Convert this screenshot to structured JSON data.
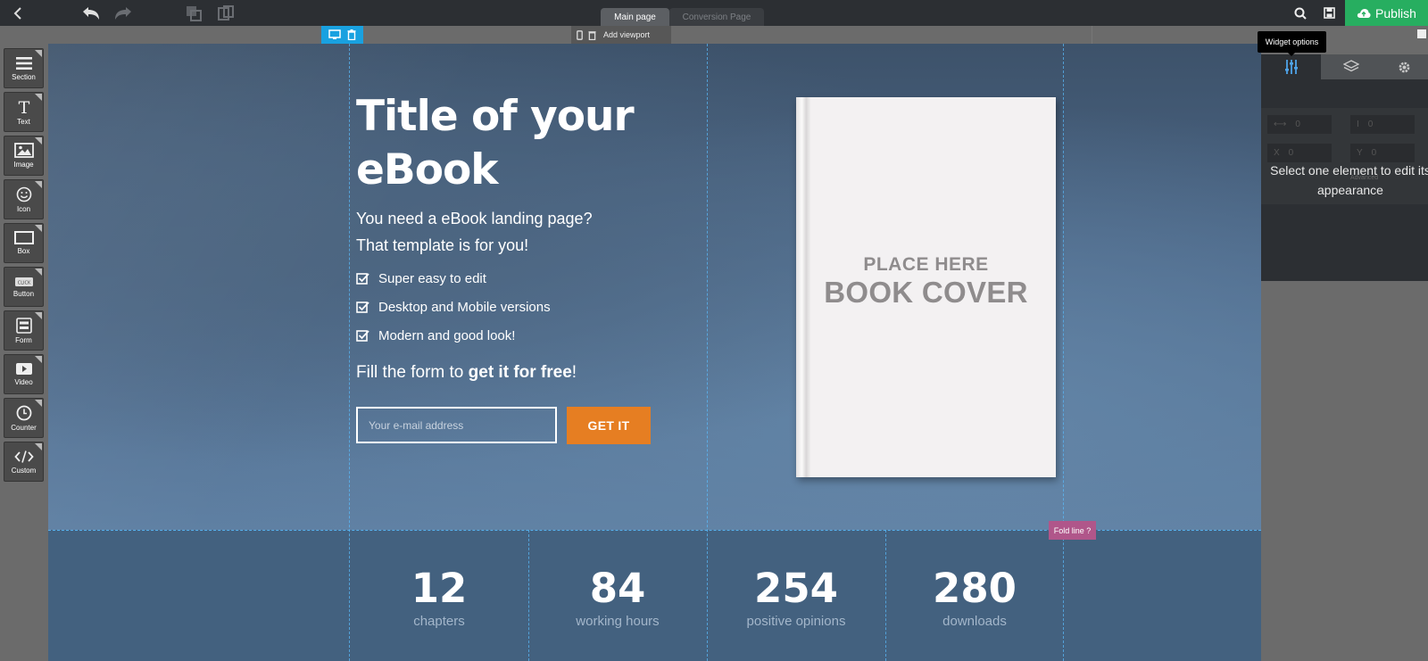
{
  "topbar": {
    "tabs": [
      "Main page",
      "Conversion Page"
    ],
    "publish_label": "Publish"
  },
  "viewport_strip": {
    "add_viewport_label": "Add viewport"
  },
  "left_toolbar": {
    "items": [
      {
        "label": "Section",
        "icon": "menu-icon"
      },
      {
        "label": "Text",
        "icon": "text-icon"
      },
      {
        "label": "Image",
        "icon": "image-icon"
      },
      {
        "label": "Icon",
        "icon": "smiley-icon"
      },
      {
        "label": "Box",
        "icon": "box-icon"
      },
      {
        "label": "Button",
        "icon": "button-icon",
        "badge": "CLICK"
      },
      {
        "label": "Form",
        "icon": "form-icon"
      },
      {
        "label": "Video",
        "icon": "play-icon"
      },
      {
        "label": "Counter",
        "icon": "clock-icon"
      },
      {
        "label": "Custom",
        "icon": "code-icon"
      }
    ]
  },
  "hero": {
    "title": "Title of your eBook",
    "subtitle_line1": "You need a eBook landing page?",
    "subtitle_line2": "That template is for you!",
    "checklist": [
      "Super easy to edit",
      "Desktop and Mobile versions",
      "Modern and good look!"
    ],
    "fill_prefix": "Fill the form to ",
    "fill_bold": "get it for free",
    "fill_suffix": "!",
    "email_placeholder": "Your e-mail address",
    "cta_label": "GET IT",
    "book_line1": "PLACE HERE",
    "book_line2": "BOOK COVER"
  },
  "fold_line": {
    "label": "Fold line ?"
  },
  "stats": [
    {
      "value": "12",
      "label": "chapters"
    },
    {
      "value": "84",
      "label": "working hours"
    },
    {
      "value": "254",
      "label": "positive opinions"
    },
    {
      "value": "280",
      "label": "downloads"
    }
  ],
  "right_panel": {
    "tooltip": "Widget options",
    "fields": [
      {
        "icon": "width-icon",
        "value": "0"
      },
      {
        "icon": "height-icon",
        "value": "0"
      },
      {
        "label": "X",
        "value": "0"
      },
      {
        "label": "Y",
        "value": "0"
      }
    ],
    "advanced_label": "Advanced",
    "message": "Select one element to edit its appearance"
  },
  "colors": {
    "publish_green": "#27ae60",
    "cta_orange": "#e67e22",
    "selection_blue": "#19a1e0",
    "fold_pink": "#b0568a",
    "active_tab_blue": "#4fa3e8"
  }
}
